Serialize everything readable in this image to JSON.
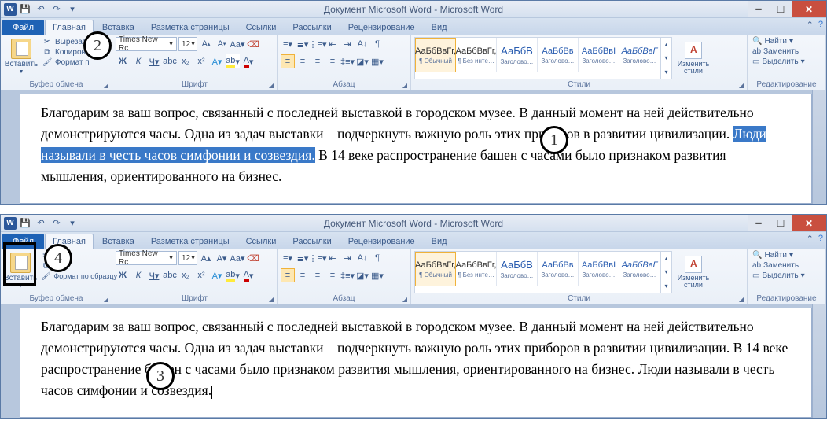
{
  "annotations": {
    "a1": "1",
    "a2": "2",
    "a3": "3",
    "a4": "4"
  },
  "window": {
    "title": "Документ Microsoft Word - Microsoft Word",
    "word_glyph": "W"
  },
  "tabs": {
    "file": "Файл",
    "home": "Главная",
    "insert": "Вставка",
    "layout": "Разметка страницы",
    "refs": "Ссылки",
    "mail": "Рассылки",
    "review": "Рецензирование",
    "view": "Вид"
  },
  "clipboard": {
    "group": "Буфер обмена",
    "paste": "Вставить",
    "cut": "Вырезать",
    "copy": "Копировать",
    "fmtpaint": "Формат по образцу",
    "cut_short": "Вырезат",
    "copy_short": "Копиров",
    "fmt_short": "Формат п"
  },
  "font": {
    "group": "Шрифт",
    "name": "Times New Rc",
    "size": "12"
  },
  "paragraph": {
    "group": "Абзац"
  },
  "styles": {
    "group": "Стили",
    "sample": "АаБбВвГг,",
    "sample2": "АаБбВ",
    "sample3": "АаБбВв",
    "sample4": "АаБбВвІ",
    "sample5": "АаБбВвГ",
    "normal": "¶ Обычный",
    "nospacing": "¶ Без инте…",
    "h1": "Заголово…",
    "h2": "Заголово…",
    "h3": "Заголово…",
    "h4": "Заголово…",
    "change": "Изменить стили"
  },
  "editing": {
    "group": "Редактирование",
    "find": "Найти",
    "replace": "Заменить",
    "select": "Выделить"
  },
  "doc1": {
    "p1a": "Благодарим за ваш вопрос, связанный с последней выставкой в городском музее. В данный момент на ней действительно демонстрируются часы.  Одна из задач выставки – подчеркнуть важную роль этих приборов в развитии цивилизации. ",
    "hl": "Люди называли в честь часов симфонии и созвездия.",
    "p1b": " В 14 веке распространение башен с часами было признаком развития мышления, ориентированного на бизнес."
  },
  "doc2": {
    "p": "Благодарим за ваш вопрос, связанный с последней выставкой в городском музее. В данный момент на ней действительно демонстрируются часы.  Одна из задач выставки – подчеркнуть важную роль этих приборов в развитии цивилизации.  В 14 веке распространение башен с часами было признаком развития мышления, ориентированного на бизнес. Люди называли в честь часов симфонии и созвездия."
  }
}
